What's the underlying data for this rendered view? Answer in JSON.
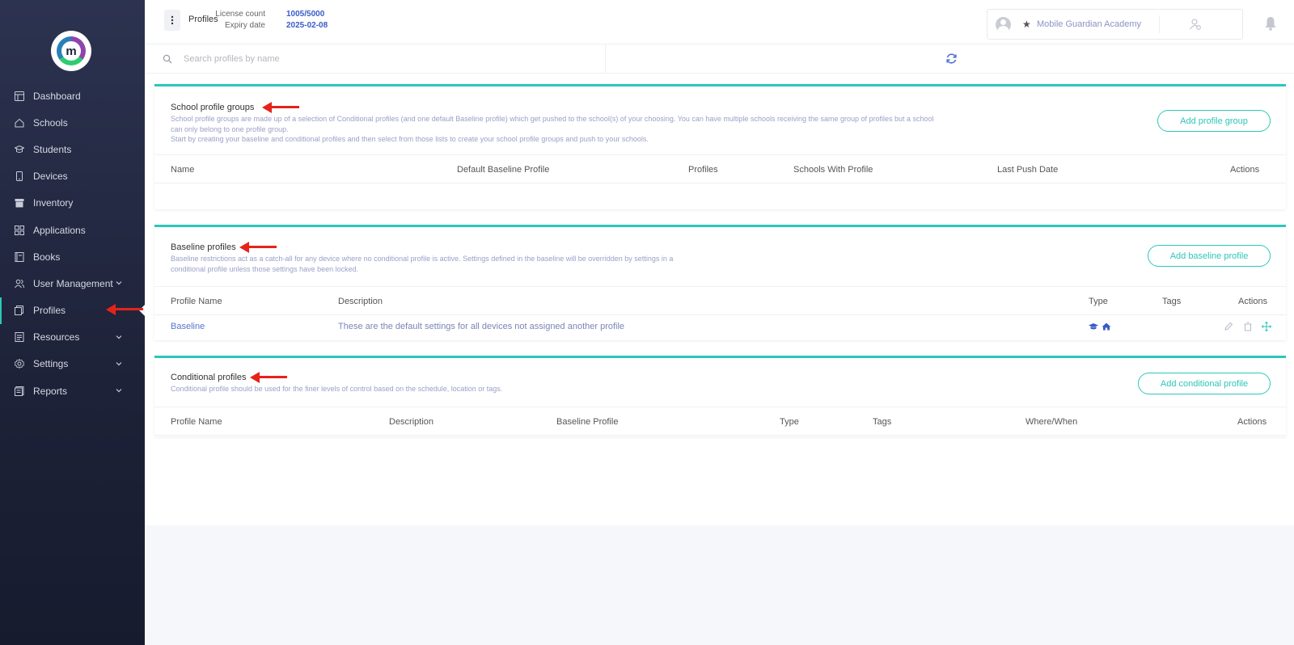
{
  "sidebar": {
    "logo_letter": "m",
    "items": [
      {
        "label": "Dashboard",
        "icon": "dashboard-icon"
      },
      {
        "label": "Schools",
        "icon": "home-icon"
      },
      {
        "label": "Students",
        "icon": "graduation-cap-icon"
      },
      {
        "label": "Devices",
        "icon": "device-icon"
      },
      {
        "label": "Inventory",
        "icon": "inventory-icon"
      },
      {
        "label": "Applications",
        "icon": "grid-icon"
      },
      {
        "label": "Books",
        "icon": "book-icon"
      },
      {
        "label": "User Management",
        "icon": "users-icon",
        "expandable": true
      },
      {
        "label": "Profiles",
        "icon": "profiles-icon",
        "active": true
      },
      {
        "label": "Resources",
        "icon": "resources-icon",
        "expandable": true
      },
      {
        "label": "Settings",
        "icon": "gear-icon",
        "expandable": true
      },
      {
        "label": "Reports",
        "icon": "reports-icon",
        "expandable": true
      }
    ]
  },
  "header": {
    "title": "Profiles",
    "license_label": "License count",
    "license_value": "1005/5000",
    "expiry_label": "Expiry date",
    "expiry_value": "2025-02-08",
    "school_name": "Mobile Guardian Academy"
  },
  "search": {
    "placeholder": "Search profiles by name",
    "value": ""
  },
  "groups": {
    "title": "School profile groups",
    "desc_1": "School profile groups are made up of a selection of Conditional profiles (and one default Baseline profile) which get pushed to the school(s) of your choosing. You can have multiple schools receiving the same group of profiles but a school can only belong to one profile group.",
    "desc_2": "Start by creating your baseline and conditional profiles and then select from those lists to create your school profile groups and push to your schools.",
    "button": "Add profile group",
    "columns": [
      "Name",
      "Default Baseline Profile",
      "Profiles",
      "Schools With Profile",
      "Last Push Date",
      "Actions"
    ]
  },
  "baseline": {
    "title": "Baseline profiles",
    "desc": "Baseline restrictions act as a catch-all for any device where no conditional profile is active. Settings defined in the baseline will be overridden by settings in a conditional profile unless those settings have been locked.",
    "button": "Add baseline profile",
    "columns": [
      "Profile Name",
      "Description",
      "Type",
      "Tags",
      "Actions"
    ],
    "rows": [
      {
        "name": "Baseline",
        "description": "These are the default settings for all devices not assigned another profile",
        "type_icons": [
          "graduation-cap-icon",
          "home-icon"
        ],
        "tags": ""
      }
    ]
  },
  "conditional": {
    "title": "Conditional profiles",
    "desc": "Conditional profile should be used for the finer levels of control based on the schedule, location or tags.",
    "button": "Add conditional profile",
    "columns": [
      "Profile Name",
      "Description",
      "Baseline Profile",
      "Type",
      "Tags",
      "Where/When",
      "Actions"
    ]
  },
  "colors": {
    "accent": "#2dc7b8",
    "link": "#3a5bc7",
    "sidebar": "#1d2238",
    "annotation_arrow": "#e5231b"
  }
}
